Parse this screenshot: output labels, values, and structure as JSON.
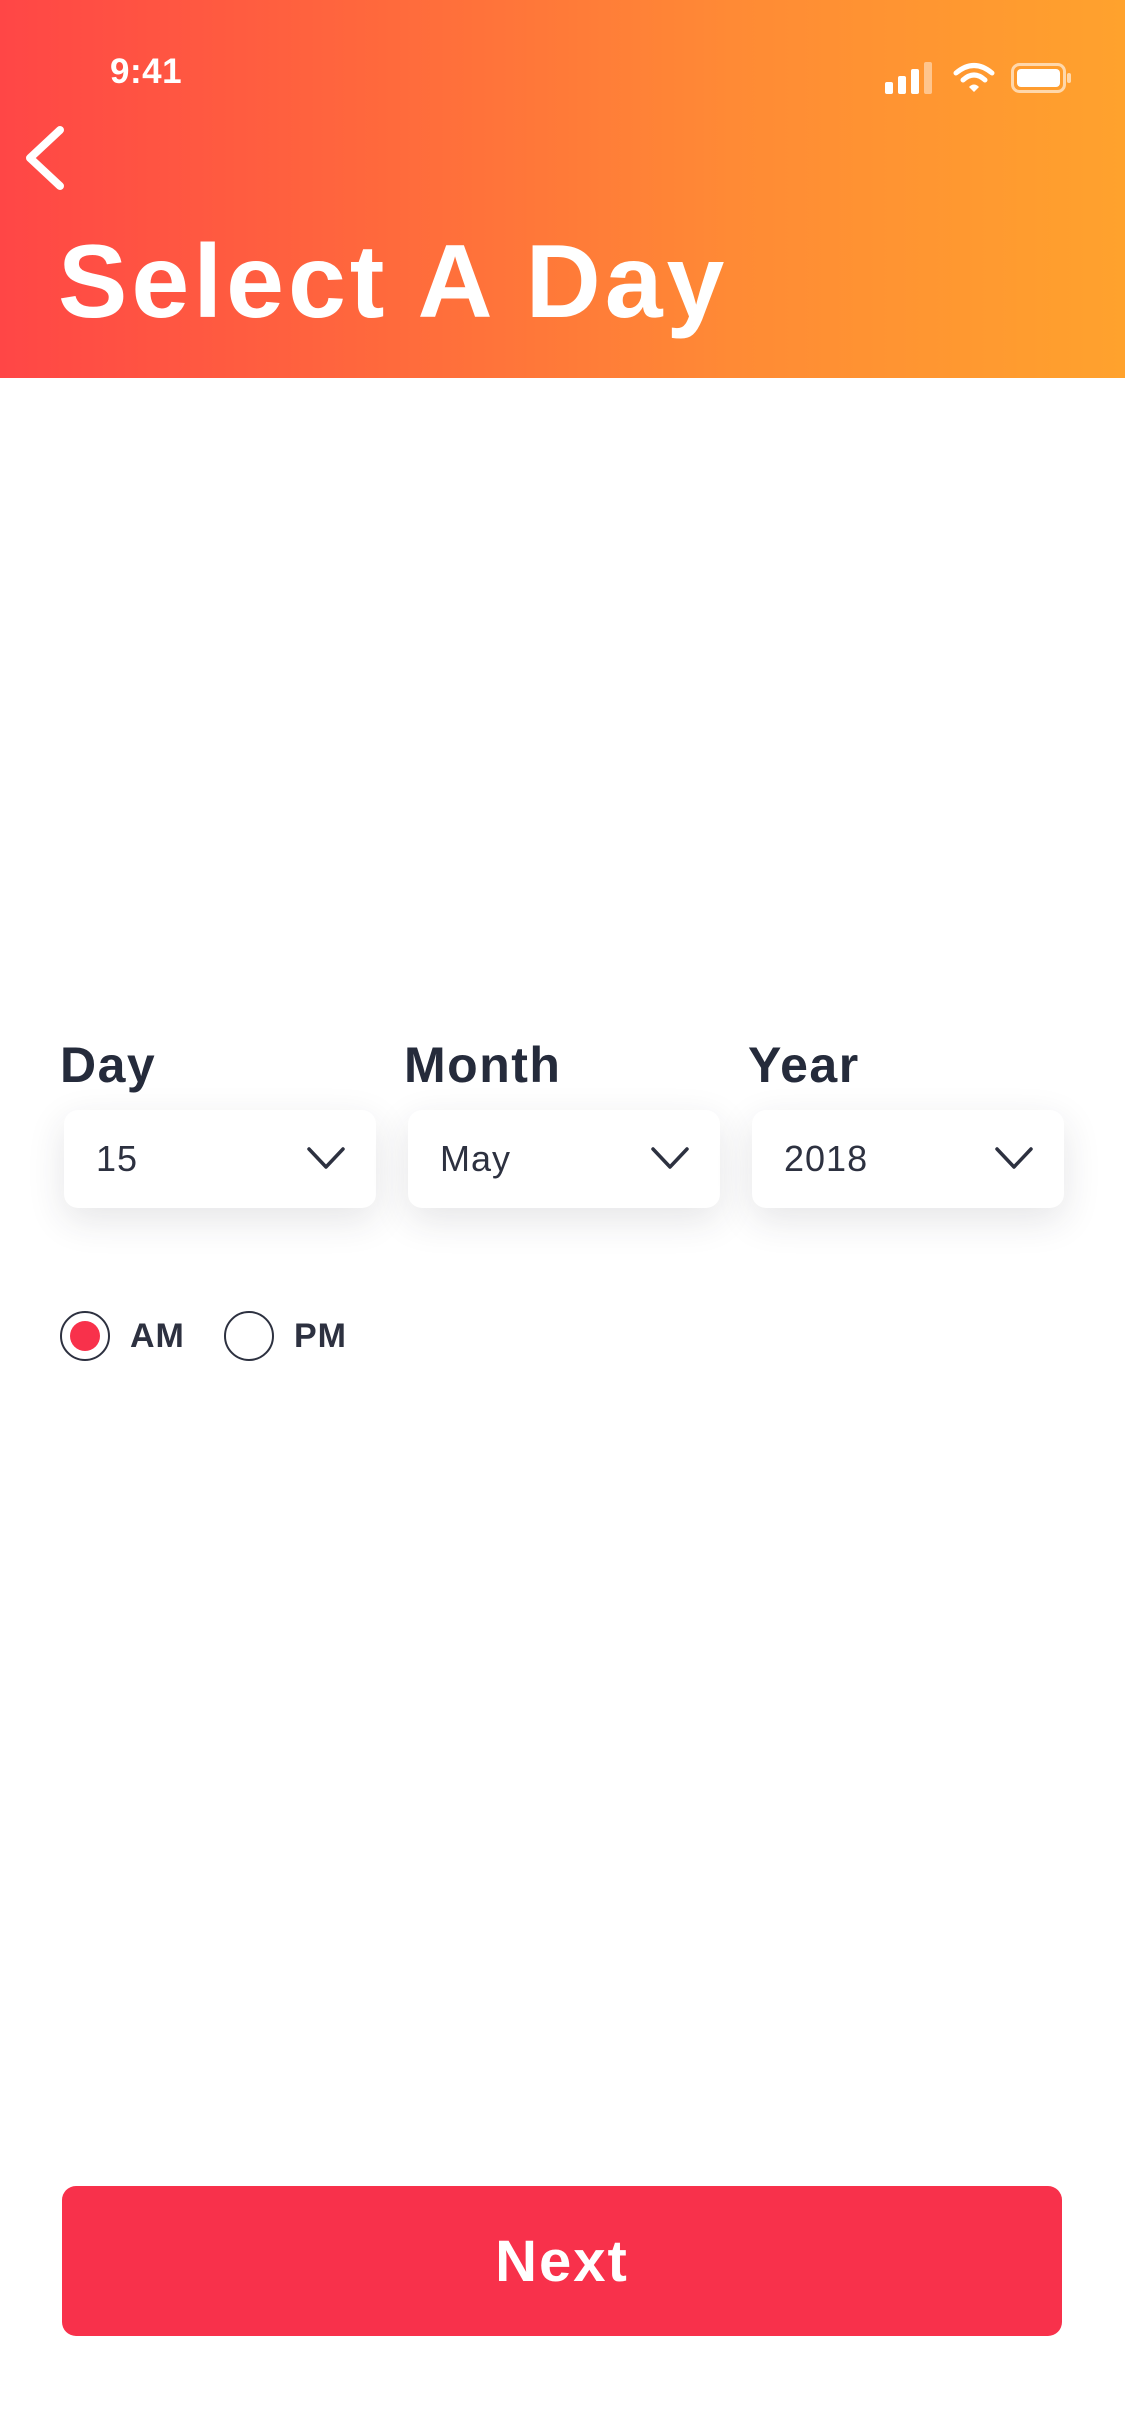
{
  "status_bar": {
    "time": "9:41",
    "icons": [
      "signal-icon",
      "wifi-icon",
      "battery-icon"
    ]
  },
  "header": {
    "back_icon": "chevron-left-icon",
    "title": "Select A Day",
    "gradient": [
      "#ff4646",
      "#ffa22d"
    ]
  },
  "date_fields": {
    "day": {
      "label": "Day",
      "value": "15"
    },
    "month": {
      "label": "Month",
      "value": "May"
    },
    "year": {
      "label": "Year",
      "value": "2018"
    }
  },
  "period": {
    "options": [
      {
        "label": "AM",
        "selected": true
      },
      {
        "label": "PM",
        "selected": false
      }
    ]
  },
  "next_button": {
    "label": "Next"
  },
  "colors": {
    "accent": "#f8314b",
    "text_dark": "#252b3b"
  }
}
